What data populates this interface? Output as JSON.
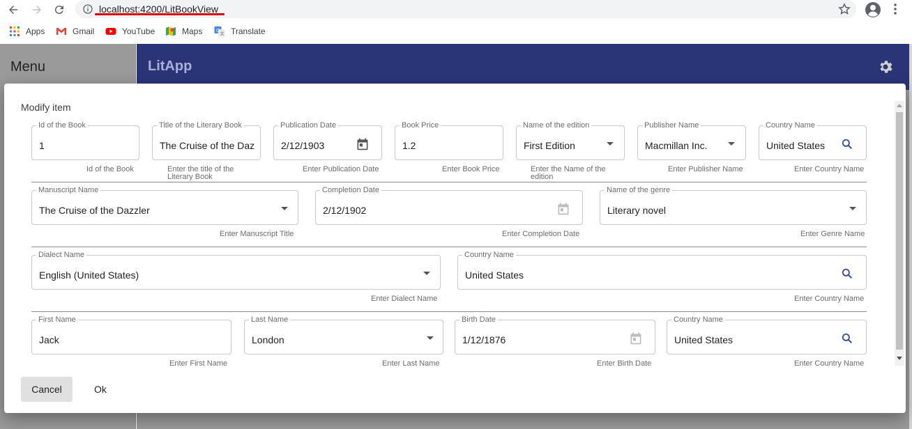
{
  "browser": {
    "url_host": "localhost",
    "url_rest": ":4200/LitBookView",
    "bookmarks": [
      {
        "label": "Apps",
        "icon": "apps-grid-icon"
      },
      {
        "label": "Gmail",
        "icon": "gmail-icon"
      },
      {
        "label": "YouTube",
        "icon": "youtube-icon"
      },
      {
        "label": "Maps",
        "icon": "maps-icon"
      },
      {
        "label": "Translate",
        "icon": "translate-icon"
      }
    ]
  },
  "app": {
    "menu_title": "Menu",
    "title": "LitApp",
    "bar_color": "#2a3578"
  },
  "dialog": {
    "title": "Modify item",
    "row1": [
      {
        "label": "Id of the Book",
        "value": "1",
        "helper": "Id of the Book"
      },
      {
        "label": "Title of the Literary Book",
        "value": "The Cruise of the Dazzler",
        "helper": "Enter the title of the Literary Book"
      },
      {
        "label": "Publication Date",
        "value": "2/12/1903",
        "helper": "Enter Publication Date"
      },
      {
        "label": "Book Price",
        "value": "1.2",
        "helper": "Enter Book Price"
      },
      {
        "label": "Name of the edition",
        "value": "First Edition",
        "helper": "Enter the Name of the edition"
      },
      {
        "label": "Publisher Name",
        "value": "Macmillan Inc.",
        "helper": "Enter Publisher Name"
      },
      {
        "label": "Country Name",
        "value": "United States",
        "helper": "Enter Country Name"
      }
    ],
    "row2": [
      {
        "label": "Manuscript Name",
        "value": "The Cruise of the Dazzler",
        "helper": "Enter Manuscript Title"
      },
      {
        "label": "Completion Date",
        "value": "2/12/1902",
        "helper": "Enter Completion Date"
      },
      {
        "label": "Name of the genre",
        "value": "Literary novel",
        "helper": "Enter Genre Name"
      }
    ],
    "row3": [
      {
        "label": "Dialect Name",
        "value": "English (United States)",
        "helper": "Enter Dialect Name"
      },
      {
        "label": "Country Name",
        "value": "United States",
        "helper": "Enter Country Name"
      }
    ],
    "row4": [
      {
        "label": "First Name",
        "value": "Jack",
        "helper": "Enter First Name"
      },
      {
        "label": "Last Name",
        "value": "London",
        "helper": "Enter Last Name"
      },
      {
        "label": "Birth Date",
        "value": "1/12/1876",
        "helper": "Enter Birth Date"
      },
      {
        "label": "Country Name",
        "value": "United States",
        "helper": "Enter Country Name"
      }
    ],
    "cancel_label": "Cancel",
    "ok_label": "Ok"
  }
}
